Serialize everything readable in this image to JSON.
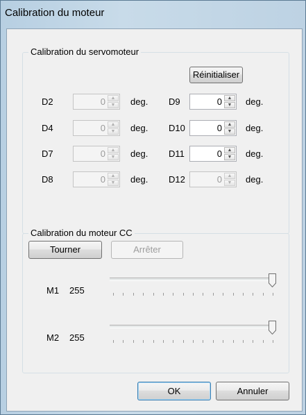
{
  "window": {
    "title": "Calibration du moteur"
  },
  "servo": {
    "title": "Calibration du servomoteur",
    "reset_label": "Réinitialiser",
    "unit": "deg.",
    "rows": [
      {
        "left": {
          "pin": "D2",
          "value": "0",
          "enabled": false
        },
        "right": {
          "pin": "D9",
          "value": "0",
          "enabled": true
        }
      },
      {
        "left": {
          "pin": "D4",
          "value": "0",
          "enabled": false
        },
        "right": {
          "pin": "D10",
          "value": "0",
          "enabled": true
        }
      },
      {
        "left": {
          "pin": "D7",
          "value": "0",
          "enabled": false
        },
        "right": {
          "pin": "D11",
          "value": "0",
          "enabled": true
        }
      },
      {
        "left": {
          "pin": "D8",
          "value": "0",
          "enabled": false
        },
        "right": {
          "pin": "D12",
          "value": "0",
          "enabled": false
        }
      }
    ]
  },
  "dc": {
    "title": "Calibration du moteur CC",
    "turn_label": "Tourner",
    "stop_label": "Arrêter",
    "stop_enabled": false,
    "sliders": [
      {
        "label": "M1",
        "value": "255",
        "level": 1.0
      },
      {
        "label": "M2",
        "value": "255",
        "level": 1.0
      }
    ]
  },
  "footer": {
    "ok_label": "OK",
    "cancel_label": "Annuler"
  }
}
